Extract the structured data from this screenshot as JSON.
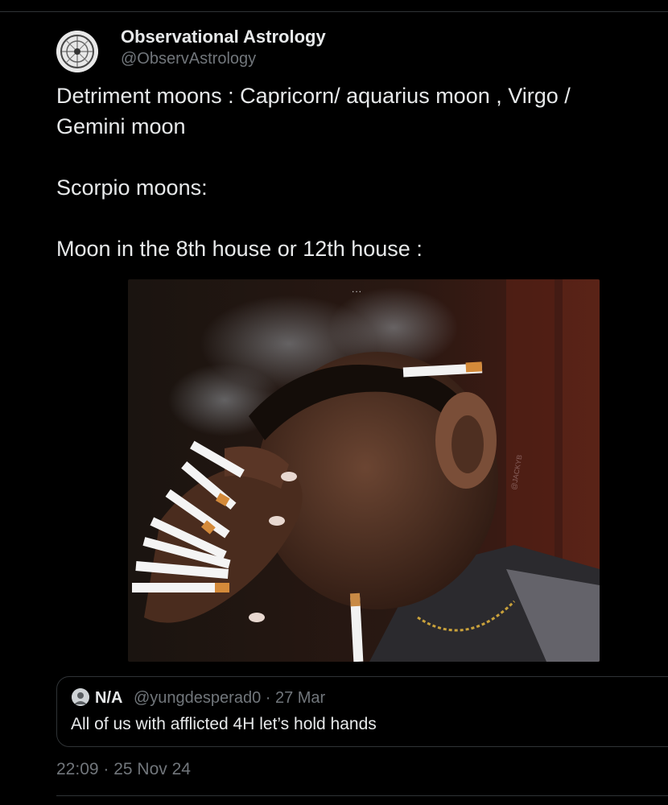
{
  "author": {
    "name": "Observational Astrology",
    "handle": "@ObservAstrology",
    "avatar_icon": "zodiac-wheel-icon"
  },
  "tweet": {
    "lines": [
      "Detriment moons : Capricorn/ aquarius moon , Virgo / Gemini moon",
      "Scorpio moons:",
      "Moon in the 8th house or 12th house :"
    ]
  },
  "media": {
    "overlay_dots": "...",
    "watermark": "@JACKYB"
  },
  "quote": {
    "name": "N/A",
    "handle": "@yungdesperad0 · 27 Mar",
    "text": "All of us with afflicted 4H let’s hold hands"
  },
  "meta": {
    "timestamp": "22:09 · 25 Nov 24"
  },
  "colors": {
    "background": "#000000",
    "text_primary": "#e7e9ea",
    "text_secondary": "#71767b",
    "border": "#2f3336"
  }
}
